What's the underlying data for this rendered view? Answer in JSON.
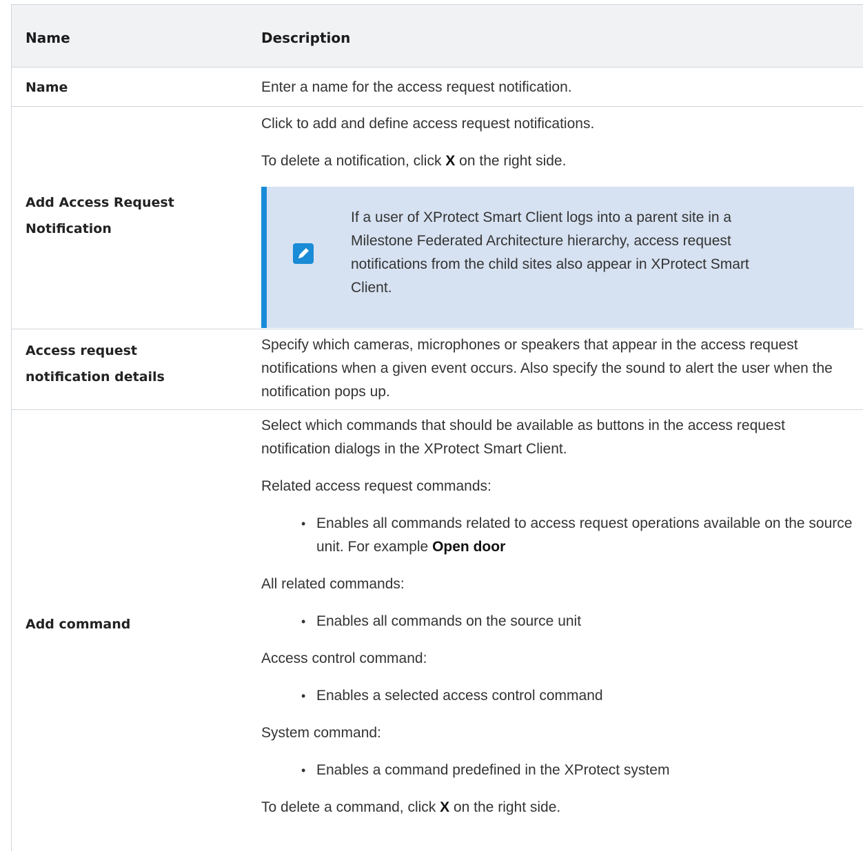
{
  "table": {
    "headers": {
      "name": "Name",
      "description": "Description"
    },
    "rows": {
      "name_row": {
        "name": "Name",
        "desc": "Enter a name for the access request notification."
      },
      "add_notification": {
        "name": "Add Access Request Notification",
        "p1": "Click to add and define access request notifications.",
        "p2_pre": "To delete a notification, click ",
        "p2_bold": "X",
        "p2_post": " on the right side.",
        "note": "If a user of XProtect Smart Client logs into a parent site in a Milestone Federated Architecture hierarchy, access request notifications from the child sites also appear in XProtect Smart Client.",
        "note_icon": "pencil-icon"
      },
      "details": {
        "name": "Access request notification details",
        "desc": "Specify which cameras, microphones or speakers that appear in the access request notifications when a given event occurs. Also specify the sound to alert the user when the notification pops up."
      },
      "add_command": {
        "name": "Add command",
        "intro": "Select which commands that should be available as buttons in the access request notification dialogs in the XProtect Smart Client.",
        "related_title": "Related access request commands:",
        "related_bullet_pre": "Enables all commands related to access request operations available on the source unit. For example ",
        "related_bullet_bold": "Open door",
        "all_title": "All related commands:",
        "all_bullet": "Enables all commands on the source unit",
        "acc_title": "Access control command:",
        "acc_bullet": "Enables a selected access control command",
        "sys_title": "System command:",
        "sys_bullet": "Enables a command predefined in the XProtect system",
        "delete_pre": "To delete a command, click ",
        "delete_bold": "X",
        "delete_post": " on the right side."
      }
    }
  },
  "colors": {
    "header_bg": "#f1f2f3",
    "note_bg": "#d6e1f1",
    "accent": "#1a8bd6",
    "border": "#cfd5da"
  }
}
